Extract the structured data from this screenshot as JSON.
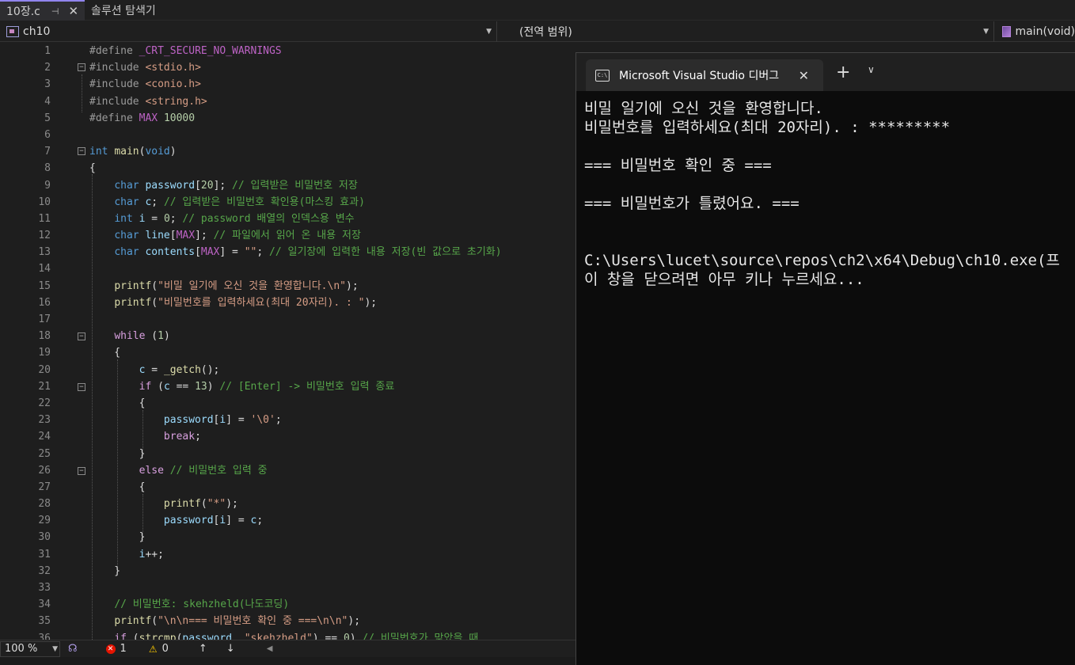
{
  "tabs": [
    {
      "label": "10장.c",
      "pin": "⊣",
      "close": "✕"
    },
    {
      "label": "솔루션 탐색기"
    }
  ],
  "nav": {
    "project": "ch10",
    "scope": "(전역 범위)",
    "member": "main(void)"
  },
  "editor": {
    "line_numbers": [
      "1",
      "2",
      "3",
      "4",
      "5",
      "6",
      "7",
      "8",
      "9",
      "10",
      "11",
      "12",
      "13",
      "14",
      "15",
      "16",
      "17",
      "18",
      "19",
      "20",
      "21",
      "22",
      "23",
      "24",
      "25",
      "26",
      "27",
      "28",
      "29",
      "30",
      "31",
      "32",
      "33",
      "34",
      "35",
      "36"
    ]
  },
  "status": {
    "zoom": "100 %",
    "errors": "1",
    "warnings": "0",
    "up": "↑",
    "down": "↓",
    "left": "◀"
  },
  "console": {
    "title": "Microsoft Visual Studio 디버그",
    "icon_label": "C:\\",
    "close": "✕",
    "plus": "+",
    "chevron": "⌄",
    "lines": [
      "비밀 일기에 오신 것을 환영합니다.",
      "비밀번호를 입력하세요(최대 20자리). : *********",
      "",
      "=== 비밀번호 확인 중 ===",
      "",
      "=== 비밀번호가 틀렸어요. ===",
      "",
      "",
      "C:\\Users\\lucet\\source\\repos\\ch2\\x64\\Debug\\ch10.exe(프",
      "이 창을 닫으려면 아무 키나 누르세요..."
    ]
  },
  "colors": {
    "accent": "#9184ee",
    "keyword": "#569cd6",
    "comment": "#57a64a",
    "string": "#d69d85",
    "function": "#dcdcaa",
    "macro": "#bd63c5",
    "control": "#d8a0df"
  }
}
